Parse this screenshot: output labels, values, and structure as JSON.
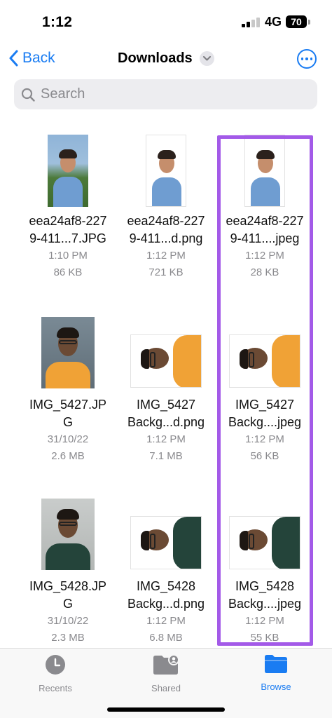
{
  "status": {
    "time": "1:12",
    "network": "4G",
    "battery": "70"
  },
  "nav": {
    "back_label": "Back",
    "title": "Downloads"
  },
  "search": {
    "placeholder": "Search"
  },
  "files": [
    {
      "name_line1": "eea24af8-227",
      "name_line2": "9-411...7.JPG",
      "time": "1:10 PM",
      "size": "86 KB"
    },
    {
      "name_line1": "eea24af8-227",
      "name_line2": "9-411...d.png",
      "time": "1:12 PM",
      "size": "721 KB"
    },
    {
      "name_line1": "eea24af8-227",
      "name_line2": "9-411....jpeg",
      "time": "1:12 PM",
      "size": "28 KB"
    },
    {
      "name_line1": "IMG_5427.JP",
      "name_line2": "G",
      "time": "31/10/22",
      "size": "2.6 MB"
    },
    {
      "name_line1": "IMG_5427",
      "name_line2": "Backg...d.png",
      "time": "1:12 PM",
      "size": "7.1 MB"
    },
    {
      "name_line1": "IMG_5427",
      "name_line2": "Backg....jpeg",
      "time": "1:12 PM",
      "size": "56 KB"
    },
    {
      "name_line1": "IMG_5428.JP",
      "name_line2": "G",
      "time": "31/10/22",
      "size": "2.3 MB"
    },
    {
      "name_line1": "IMG_5428",
      "name_line2": "Backg...d.png",
      "time": "1:12 PM",
      "size": "6.8 MB"
    },
    {
      "name_line1": "IMG_5428",
      "name_line2": "Backg....jpeg",
      "time": "1:12 PM",
      "size": "55 KB"
    }
  ],
  "tabs": [
    {
      "label": "Recents",
      "icon": "clock-icon"
    },
    {
      "label": "Shared",
      "icon": "shared-folder-icon"
    },
    {
      "label": "Browse",
      "icon": "folder-icon"
    }
  ],
  "colors": {
    "accent": "#1a7cf2",
    "highlight": "#a35ae8"
  }
}
